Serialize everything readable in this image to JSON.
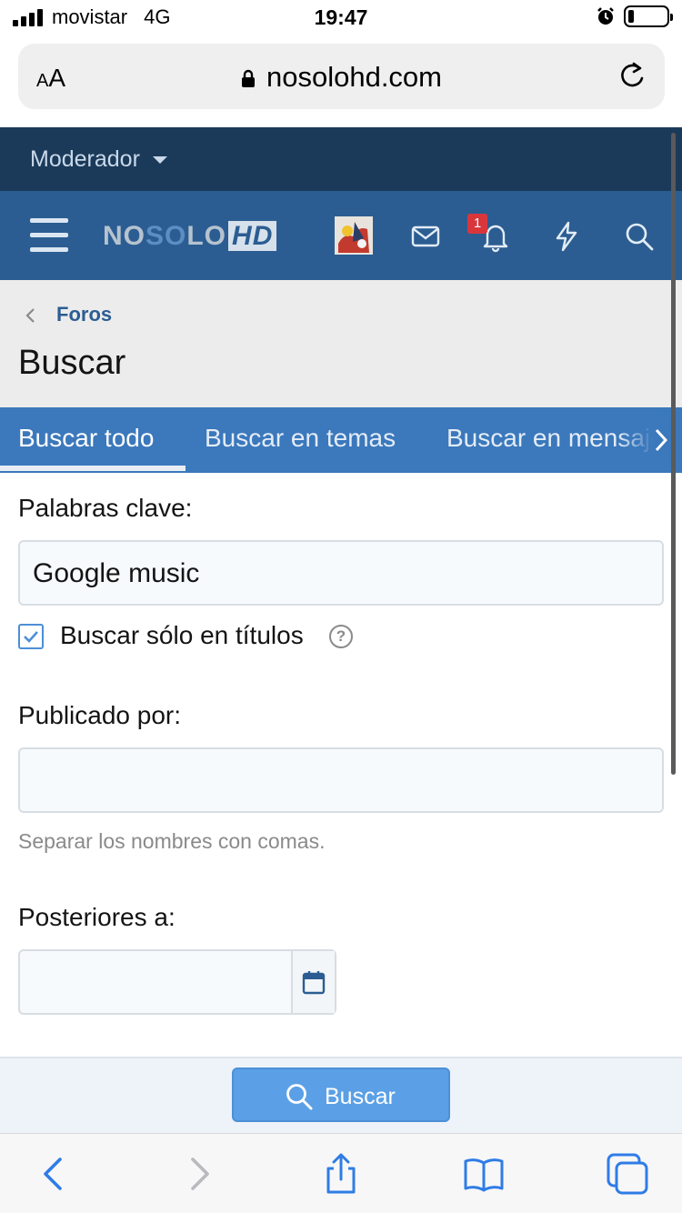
{
  "status_bar": {
    "carrier": "movistar",
    "network": "4G",
    "time": "19:47",
    "battery_level": 0.15,
    "alarm_icon": "alarm-clock-icon"
  },
  "address_bar": {
    "text_size_button": "AA",
    "url": "nosolohd.com",
    "lock_icon": "lock-icon",
    "reload_icon": "reload-icon"
  },
  "moderator_bar": {
    "label": "Moderador"
  },
  "nav": {
    "menu_icon": "hamburger-menu-icon",
    "logo_no": "NO",
    "logo_so": "SO",
    "logo_lo": "LO",
    "logo_hd": "HD",
    "notification_count": "1",
    "icons": [
      "avatar",
      "envelope-icon",
      "bell-icon",
      "lightning-icon",
      "search-icon"
    ]
  },
  "breadcrumb": {
    "link": "Foros"
  },
  "page_title": "Buscar",
  "tabs": [
    {
      "label": "Buscar todo",
      "active": true
    },
    {
      "label": "Buscar en temas",
      "active": false
    },
    {
      "label": "Buscar en mensajes",
      "active": false
    }
  ],
  "form": {
    "keywords_label": "Palabras clave:",
    "keywords_value": "Google music",
    "titles_only_label": "Buscar sólo en títulos",
    "titles_only_checked": true,
    "help_glyph": "?",
    "posted_by_label": "Publicado por:",
    "posted_by_value": "",
    "posted_by_hint": "Separar los nombres con comas.",
    "newer_than_label": "Posteriores a:",
    "newer_than_value": "",
    "submit_label": "Buscar"
  },
  "colors": {
    "moderator_bar": "#1b3a5a",
    "nav_bar": "#2b5d92",
    "tabs_bar": "#3b78bc",
    "link": "#2b5d92",
    "submit_button": "#5ba0e6",
    "badge": "#d9363c",
    "safari_blue": "#2f7ce6"
  }
}
